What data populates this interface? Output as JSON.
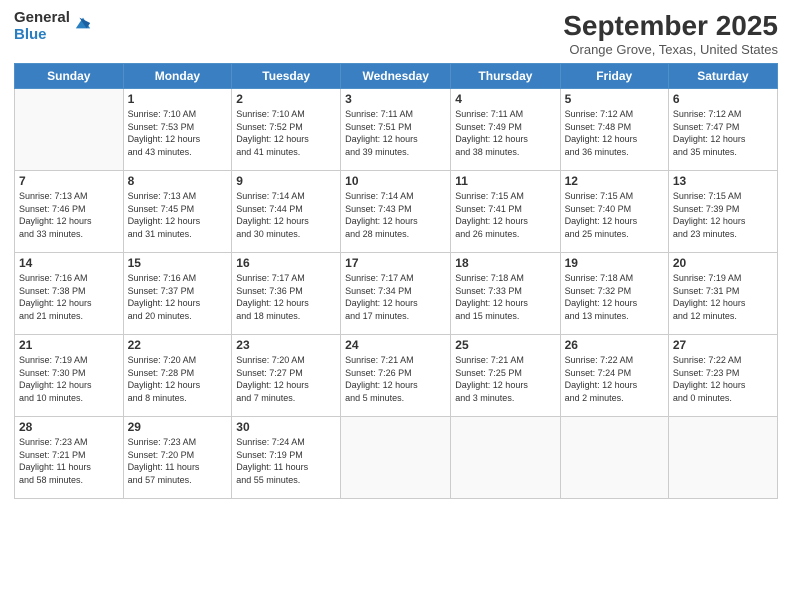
{
  "header": {
    "logo": {
      "general": "General",
      "blue": "Blue"
    },
    "title": "September 2025",
    "location": "Orange Grove, Texas, United States"
  },
  "days_of_week": [
    "Sunday",
    "Monday",
    "Tuesday",
    "Wednesday",
    "Thursday",
    "Friday",
    "Saturday"
  ],
  "weeks": [
    [
      {
        "day": "",
        "info": ""
      },
      {
        "day": "1",
        "info": "Sunrise: 7:10 AM\nSunset: 7:53 PM\nDaylight: 12 hours\nand 43 minutes."
      },
      {
        "day": "2",
        "info": "Sunrise: 7:10 AM\nSunset: 7:52 PM\nDaylight: 12 hours\nand 41 minutes."
      },
      {
        "day": "3",
        "info": "Sunrise: 7:11 AM\nSunset: 7:51 PM\nDaylight: 12 hours\nand 39 minutes."
      },
      {
        "day": "4",
        "info": "Sunrise: 7:11 AM\nSunset: 7:49 PM\nDaylight: 12 hours\nand 38 minutes."
      },
      {
        "day": "5",
        "info": "Sunrise: 7:12 AM\nSunset: 7:48 PM\nDaylight: 12 hours\nand 36 minutes."
      },
      {
        "day": "6",
        "info": "Sunrise: 7:12 AM\nSunset: 7:47 PM\nDaylight: 12 hours\nand 35 minutes."
      }
    ],
    [
      {
        "day": "7",
        "info": "Sunrise: 7:13 AM\nSunset: 7:46 PM\nDaylight: 12 hours\nand 33 minutes."
      },
      {
        "day": "8",
        "info": "Sunrise: 7:13 AM\nSunset: 7:45 PM\nDaylight: 12 hours\nand 31 minutes."
      },
      {
        "day": "9",
        "info": "Sunrise: 7:14 AM\nSunset: 7:44 PM\nDaylight: 12 hours\nand 30 minutes."
      },
      {
        "day": "10",
        "info": "Sunrise: 7:14 AM\nSunset: 7:43 PM\nDaylight: 12 hours\nand 28 minutes."
      },
      {
        "day": "11",
        "info": "Sunrise: 7:15 AM\nSunset: 7:41 PM\nDaylight: 12 hours\nand 26 minutes."
      },
      {
        "day": "12",
        "info": "Sunrise: 7:15 AM\nSunset: 7:40 PM\nDaylight: 12 hours\nand 25 minutes."
      },
      {
        "day": "13",
        "info": "Sunrise: 7:15 AM\nSunset: 7:39 PM\nDaylight: 12 hours\nand 23 minutes."
      }
    ],
    [
      {
        "day": "14",
        "info": "Sunrise: 7:16 AM\nSunset: 7:38 PM\nDaylight: 12 hours\nand 21 minutes."
      },
      {
        "day": "15",
        "info": "Sunrise: 7:16 AM\nSunset: 7:37 PM\nDaylight: 12 hours\nand 20 minutes."
      },
      {
        "day": "16",
        "info": "Sunrise: 7:17 AM\nSunset: 7:36 PM\nDaylight: 12 hours\nand 18 minutes."
      },
      {
        "day": "17",
        "info": "Sunrise: 7:17 AM\nSunset: 7:34 PM\nDaylight: 12 hours\nand 17 minutes."
      },
      {
        "day": "18",
        "info": "Sunrise: 7:18 AM\nSunset: 7:33 PM\nDaylight: 12 hours\nand 15 minutes."
      },
      {
        "day": "19",
        "info": "Sunrise: 7:18 AM\nSunset: 7:32 PM\nDaylight: 12 hours\nand 13 minutes."
      },
      {
        "day": "20",
        "info": "Sunrise: 7:19 AM\nSunset: 7:31 PM\nDaylight: 12 hours\nand 12 minutes."
      }
    ],
    [
      {
        "day": "21",
        "info": "Sunrise: 7:19 AM\nSunset: 7:30 PM\nDaylight: 12 hours\nand 10 minutes."
      },
      {
        "day": "22",
        "info": "Sunrise: 7:20 AM\nSunset: 7:28 PM\nDaylight: 12 hours\nand 8 minutes."
      },
      {
        "day": "23",
        "info": "Sunrise: 7:20 AM\nSunset: 7:27 PM\nDaylight: 12 hours\nand 7 minutes."
      },
      {
        "day": "24",
        "info": "Sunrise: 7:21 AM\nSunset: 7:26 PM\nDaylight: 12 hours\nand 5 minutes."
      },
      {
        "day": "25",
        "info": "Sunrise: 7:21 AM\nSunset: 7:25 PM\nDaylight: 12 hours\nand 3 minutes."
      },
      {
        "day": "26",
        "info": "Sunrise: 7:22 AM\nSunset: 7:24 PM\nDaylight: 12 hours\nand 2 minutes."
      },
      {
        "day": "27",
        "info": "Sunrise: 7:22 AM\nSunset: 7:23 PM\nDaylight: 12 hours\nand 0 minutes."
      }
    ],
    [
      {
        "day": "28",
        "info": "Sunrise: 7:23 AM\nSunset: 7:21 PM\nDaylight: 11 hours\nand 58 minutes."
      },
      {
        "day": "29",
        "info": "Sunrise: 7:23 AM\nSunset: 7:20 PM\nDaylight: 11 hours\nand 57 minutes."
      },
      {
        "day": "30",
        "info": "Sunrise: 7:24 AM\nSunset: 7:19 PM\nDaylight: 11 hours\nand 55 minutes."
      },
      {
        "day": "",
        "info": ""
      },
      {
        "day": "",
        "info": ""
      },
      {
        "day": "",
        "info": ""
      },
      {
        "day": "",
        "info": ""
      }
    ]
  ]
}
